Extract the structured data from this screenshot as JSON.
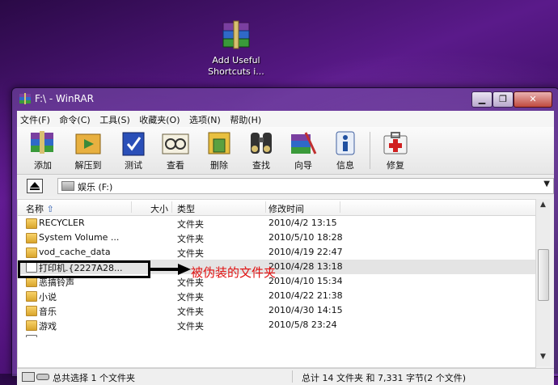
{
  "desktop": {
    "icon_label": "Add Useful\nShortcuts i..."
  },
  "window": {
    "title": "F:\\ - WinRAR",
    "min_label": "▁",
    "max_label": "❐",
    "close_label": "✕"
  },
  "menu": [
    "文件(F)",
    "命令(C)",
    "工具(S)",
    "收藏夹(O)",
    "选项(N)",
    "帮助(H)"
  ],
  "toolbar": [
    {
      "label": "添加",
      "icon": "add-archive-icon"
    },
    {
      "label": "解压到",
      "icon": "extract-to-icon"
    },
    {
      "label": "测试",
      "icon": "test-icon"
    },
    {
      "label": "查看",
      "icon": "view-icon"
    },
    {
      "label": "删除",
      "icon": "delete-icon"
    },
    {
      "label": "查找",
      "icon": "find-icon"
    },
    {
      "label": "向导",
      "icon": "wizard-icon"
    },
    {
      "label": "信息",
      "icon": "info-icon"
    },
    {
      "label": "修复",
      "icon": "repair-icon"
    }
  ],
  "path": {
    "value": "娱乐 (F:)",
    "up_label": "▲"
  },
  "columns": {
    "name": "名称",
    "size": "大小",
    "type": "类型",
    "modified": "修改时间"
  },
  "files": [
    {
      "name": "RECYCLER",
      "size": "",
      "type": "文件夹",
      "modified": "2010/4/2 13:15"
    },
    {
      "name": "System Volume ...",
      "size": "",
      "type": "文件夹",
      "modified": "2010/5/10 18:28"
    },
    {
      "name": "vod_cache_data",
      "size": "",
      "type": "文件夹",
      "modified": "2010/4/19 22:47"
    },
    {
      "name": "打印机.{2227A28...",
      "size": "",
      "type": "",
      "modified": "2010/4/28 13:18"
    },
    {
      "name": "恶搞铃声",
      "size": "",
      "type": "文件夹",
      "modified": "2010/4/10 15:34"
    },
    {
      "name": "小说",
      "size": "",
      "type": "文件夹",
      "modified": "2010/4/22 21:38"
    },
    {
      "name": "音乐",
      "size": "",
      "type": "文件夹",
      "modified": "2010/4/30 14:15"
    },
    {
      "name": "游戏",
      "size": "",
      "type": "文件夹",
      "modified": "2010/5/8 23:24"
    }
  ],
  "status": {
    "left": "总共选择 1 个文件夹",
    "right": "总计 14 文件夹 和 7,331 字节(2 个文件)"
  },
  "annotation": {
    "text": "被伪装的文件夹",
    "color": "#e01010"
  }
}
